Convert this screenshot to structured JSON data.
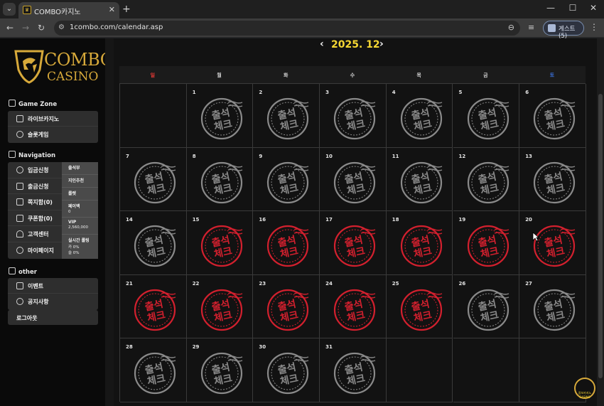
{
  "browser": {
    "tab_title": "COMBO카지노",
    "url": "1combo.com/calendar.asp",
    "profile_label": "게스트(5)"
  },
  "logo": {
    "line1": "COMBO",
    "line2": "CASINO"
  },
  "sidebar": {
    "game_zone": {
      "title": "Game Zone",
      "items": [
        {
          "label": "라이브카지노"
        },
        {
          "label": "슬롯게임"
        }
      ]
    },
    "navigation": {
      "title": "Navigation",
      "items": [
        {
          "label": "입금신청"
        },
        {
          "label": "출금신청"
        },
        {
          "label": "쪽지함(0)"
        },
        {
          "label": "쿠폰함(0)"
        },
        {
          "label": "고객센터"
        },
        {
          "label": "마이페이지"
        }
      ],
      "info": [
        {
          "label": "출석부",
          "value": ""
        },
        {
          "label": "지인추천",
          "value": ""
        },
        {
          "label": "룰렛",
          "value": ""
        },
        {
          "label": "페이백",
          "value": "0"
        },
        {
          "label": "VIP",
          "value": "2,560,000"
        },
        {
          "label": "실시간 롤링",
          "value": "카 0%\n슬 0%"
        }
      ]
    },
    "other": {
      "title": "other",
      "items": [
        {
          "label": "이벤트"
        },
        {
          "label": "공지사항"
        }
      ]
    },
    "logout_label": "로그아웃"
  },
  "calendar": {
    "title": "2025. 12",
    "weekdays": [
      "일",
      "월",
      "화",
      "수",
      "목",
      "금",
      "토"
    ],
    "weekday_colors": [
      "#e53935",
      "#d6d6d6",
      "#d6d6d6",
      "#d6d6d6",
      "#d6d6d6",
      "#d6d6d6",
      "#3b6fd8"
    ],
    "stamp_text": [
      "출석",
      "체크"
    ],
    "stamp_colors": {
      "gray": "#8a8a8a",
      "red": "#d3202e"
    },
    "start_offset": 1,
    "days_in_month": 31,
    "checked_days": [
      15,
      16,
      17,
      18,
      19,
      20,
      21,
      22,
      23,
      24,
      25
    ]
  },
  "float_badge_label": "콤보카지노 CASINO"
}
